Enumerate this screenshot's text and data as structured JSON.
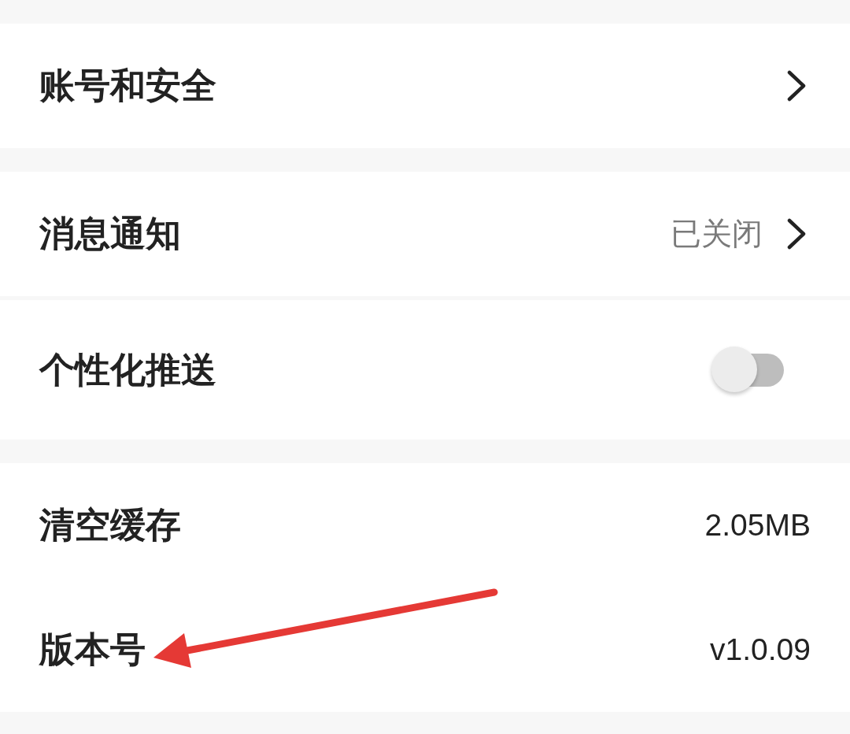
{
  "sections": [
    {
      "rows": [
        {
          "kind": "link",
          "label": "账号和安全"
        }
      ]
    },
    {
      "dividers": true,
      "rows": [
        {
          "kind": "link",
          "label": "消息通知",
          "value": "已关闭"
        },
        {
          "kind": "toggle",
          "label": "个性化推送",
          "on": false
        }
      ]
    },
    {
      "dividers": false,
      "rows": [
        {
          "kind": "value",
          "label": "清空缓存",
          "value": "2.05MB"
        },
        {
          "kind": "value",
          "label": "版本号",
          "value": "v1.0.09"
        }
      ]
    }
  ],
  "annotation": {
    "kind": "arrow"
  }
}
